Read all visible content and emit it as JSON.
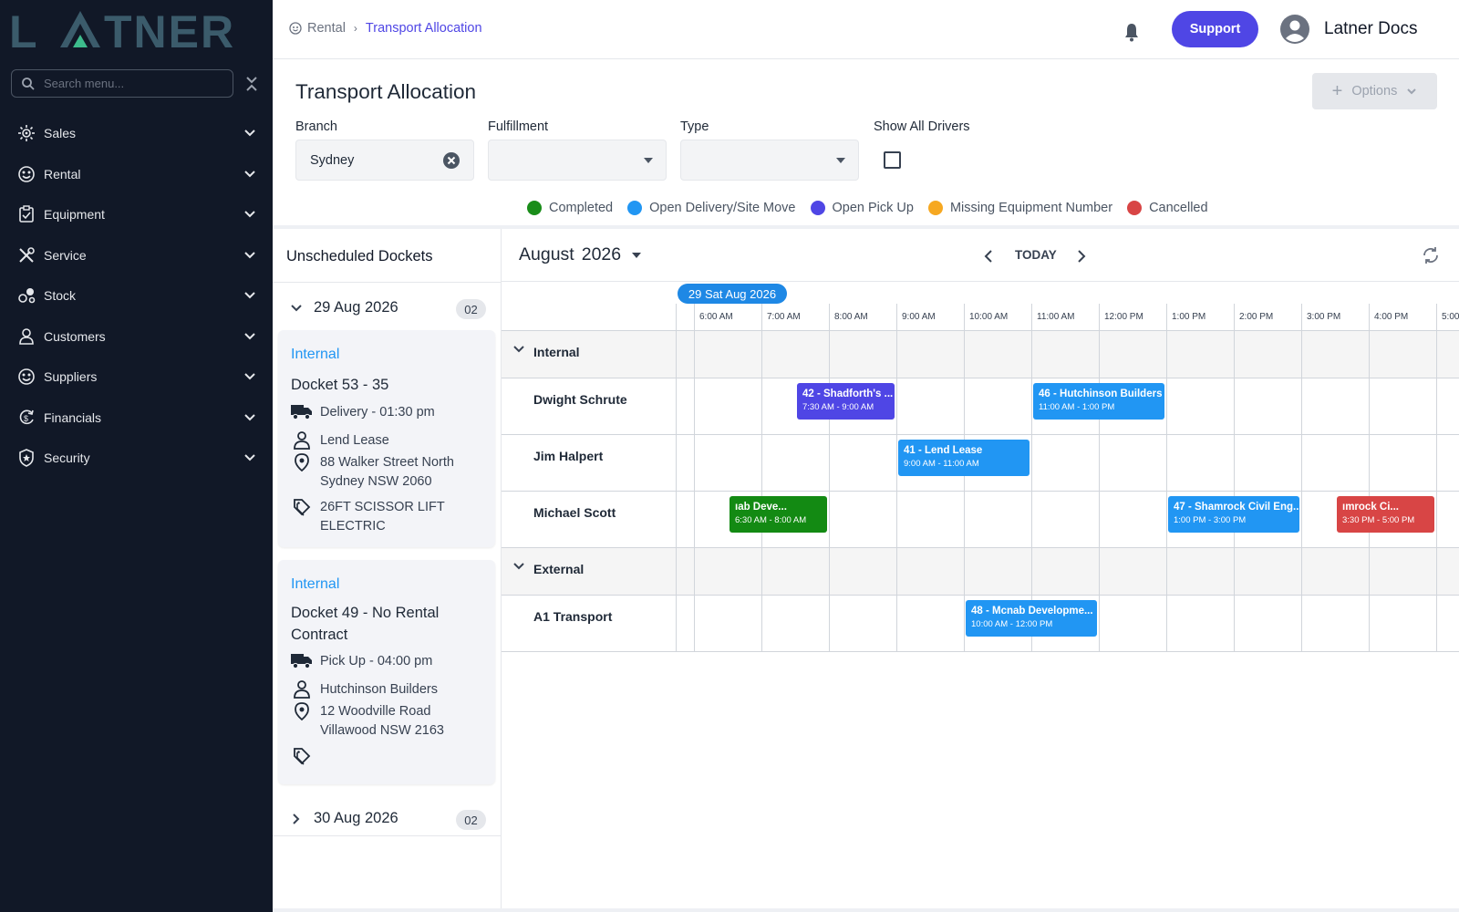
{
  "brand": {
    "logo_text": "LATNER"
  },
  "sidebar": {
    "search_placeholder": "Search menu...",
    "items": [
      {
        "label": "Sales",
        "icon": "sales-icon"
      },
      {
        "label": "Rental",
        "icon": "rental-icon"
      },
      {
        "label": "Equipment",
        "icon": "equipment-icon"
      },
      {
        "label": "Service",
        "icon": "service-icon"
      },
      {
        "label": "Stock",
        "icon": "stock-icon"
      },
      {
        "label": "Customers",
        "icon": "customers-icon"
      },
      {
        "label": "Suppliers",
        "icon": "suppliers-icon"
      },
      {
        "label": "Financials",
        "icon": "financials-icon"
      },
      {
        "label": "Security",
        "icon": "security-icon"
      }
    ]
  },
  "header": {
    "breadcrumb": [
      "Rental",
      "Transport Allocation"
    ],
    "support_label": "Support",
    "user_name": "Latner Docs"
  },
  "page": {
    "title": "Transport Allocation",
    "options_label": "Options"
  },
  "filters": {
    "branch_label": "Branch",
    "branch_value": "Sydney",
    "fulfillment_label": "Fulfillment",
    "fulfillment_value": "",
    "type_label": "Type",
    "type_value": "",
    "show_all_drivers_label": "Show All Drivers",
    "show_all_drivers_checked": false
  },
  "legend": [
    {
      "label": "Completed",
      "color": "#1a8d1a"
    },
    {
      "label": "Open Delivery/Site Move",
      "color": "#2196f3"
    },
    {
      "label": "Open Pick Up",
      "color": "#4f46e5"
    },
    {
      "label": "Missing Equipment Number",
      "color": "#f6a821"
    },
    {
      "label": "Cancelled",
      "color": "#d84545"
    }
  ],
  "unscheduled": {
    "title": "Unscheduled Dockets",
    "groups": [
      {
        "date": "29 Aug 2026",
        "count": "02",
        "expanded": true,
        "cards": [
          {
            "type": "Internal",
            "title": "Docket 53 - 35",
            "service": "Delivery - 01:30 pm",
            "customer": "Lend Lease",
            "address_line1": "88 Walker Street North",
            "address_line2": "Sydney NSW 2060",
            "equipment_line1": "26FT SCISSOR LIFT",
            "equipment_line2": "ELECTRIC"
          },
          {
            "type": "Internal",
            "title_line1": "Docket 49 - No Rental",
            "title_line2": "Contract",
            "service": "Pick Up - 04:00 pm",
            "customer": "Hutchinson Builders",
            "address_line1": "12 Woodville Road",
            "address_line2": "Villawood NSW 2163",
            "equipment_line1": ""
          }
        ]
      },
      {
        "date": "30 Aug 2026",
        "count": "02",
        "expanded": false
      }
    ]
  },
  "calendar": {
    "month": "August",
    "year": "2026",
    "today_label": "TODAY",
    "date_pill": "29 Sat Aug 2026",
    "time_slots": [
      "6:00 AM",
      "7:00 AM",
      "8:00 AM",
      "9:00 AM",
      "10:00 AM",
      "11:00 AM",
      "12:00 PM",
      "1:00 PM",
      "2:00 PM",
      "3:00 PM",
      "4:00 PM",
      "5:00"
    ],
    "groups": [
      {
        "name": "Internal",
        "drivers": [
          "Dwight Schrute",
          "Jim Halpert",
          "Michael Scott"
        ]
      },
      {
        "name": "External",
        "drivers": [
          "A1 Transport"
        ]
      }
    ],
    "events": [
      {
        "title": "42 - Shadforth's ...",
        "time": "7:30 AM - 9:00 AM",
        "driver": "Dwight Schrute",
        "start": 7.5,
        "end": 9.0,
        "color": "#4f46e5"
      },
      {
        "title": "46 - Hutchinson Builders",
        "time": "11:00 AM - 1:00 PM",
        "driver": "Dwight Schrute",
        "start": 11.0,
        "end": 13.0,
        "color": "#2196f3"
      },
      {
        "title": "41 - Lend Lease",
        "time": "9:00 AM - 11:00 AM",
        "driver": "Jim Halpert",
        "start": 9.0,
        "end": 11.0,
        "color": "#2196f3"
      },
      {
        "title": "ıab Deve...",
        "time": "6:30 AM - 8:00 AM",
        "driver": "Michael Scott",
        "start": 6.5,
        "end": 8.0,
        "color": "#138a13"
      },
      {
        "title": "47 - Shamrock Civil Eng...",
        "time": "1:00 PM - 3:00 PM",
        "driver": "Michael Scott",
        "start": 13.0,
        "end": 15.0,
        "color": "#2196f3"
      },
      {
        "title": "ımrock Ci...",
        "time": "3:30 PM - 5:00 PM",
        "driver": "Michael Scott",
        "start": 15.5,
        "end": 17.0,
        "color": "#d84545"
      },
      {
        "title": "48 - Mcnab Developme...",
        "time": "10:00 AM - 12:00 PM",
        "driver": "A1 Transport",
        "start": 10.0,
        "end": 12.0,
        "color": "#2196f3"
      }
    ]
  }
}
